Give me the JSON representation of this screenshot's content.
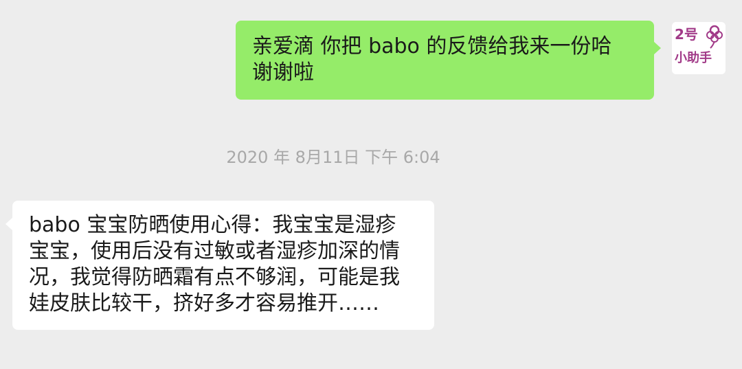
{
  "messages": [
    {
      "side": "sent",
      "text": "亲爱滴 你把 babo 的反馈给我来一份哈 谢谢啦",
      "avatar": {
        "line1": "2号",
        "line2": "小助手",
        "icon": "flower-icon"
      }
    },
    {
      "side": "received",
      "text": "babo 宝宝防晒使用心得：我宝宝是湿疹宝宝，使用后没有过敏或者湿疹加深的情况，我觉得防晒霜有点不够润，可能是我娃皮肤比较干，挤好多才容易推开……"
    }
  ],
  "timestamp": "2020 年 8月11日  下午 6:04",
  "colors": {
    "background": "#ededed",
    "sent_bubble": "#95ec69",
    "received_bubble": "#ffffff",
    "timestamp_text": "#a8a8a8",
    "avatar_accent": "#a13a88"
  }
}
